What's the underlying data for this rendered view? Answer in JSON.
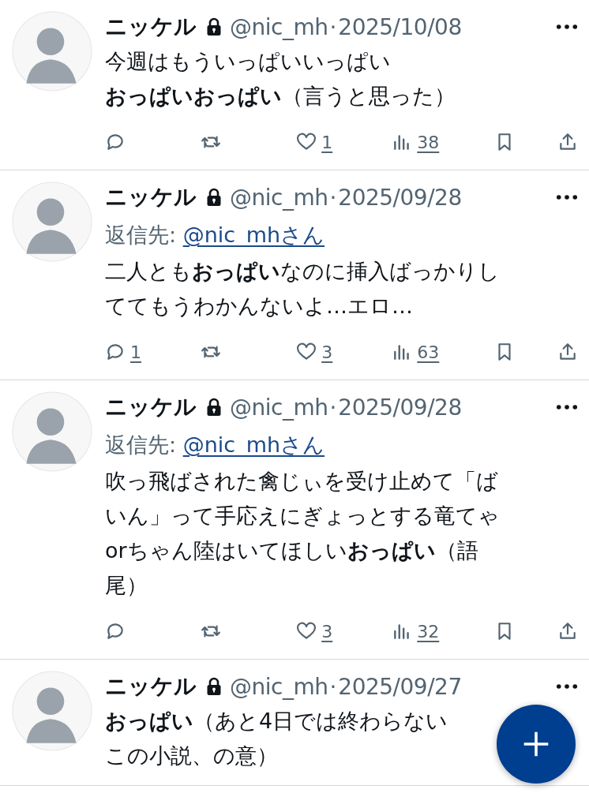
{
  "tweets": [
    {
      "name": "ニッケル",
      "handle": "@nic_mh",
      "separator": "·",
      "date": "2025/10/08",
      "lines": [
        "今週はもういっぱいいっぱい",
        "**おっぱいおっぱい**（言うと思った）"
      ],
      "likes": "1",
      "views": "38"
    },
    {
      "name": "ニッケル",
      "handle": "@nic_mh",
      "separator": "·",
      "date": "2025/09/28",
      "reply_label": "返信先: ",
      "reply_target": "@nic_mhさん",
      "lines": [
        "二人とも**おっぱい**なのに挿入ばっかりし",
        "ててもうわかんないよ…エロ…"
      ],
      "replies": "1",
      "likes": "3",
      "views": "63"
    },
    {
      "name": "ニッケル",
      "handle": "@nic_mh",
      "separator": "·",
      "date": "2025/09/28",
      "reply_label": "返信先: ",
      "reply_target": "@nic_mhさん",
      "lines": [
        "吹っ飛ばされた禽じぃを受け止めて「ば",
        "いん」って手応えにぎょっとする竜てゃ",
        "orちゃん陸はいてほしい**おっぱい**（語",
        "尾）"
      ],
      "likes": "3",
      "views": "32"
    },
    {
      "name": "ニッケル",
      "handle": "@nic_mh",
      "separator": "·",
      "date": "2025/09/27",
      "lines": [
        "**おっぱい**（あと4日では終わらない",
        "この小説、の意）"
      ]
    }
  ]
}
